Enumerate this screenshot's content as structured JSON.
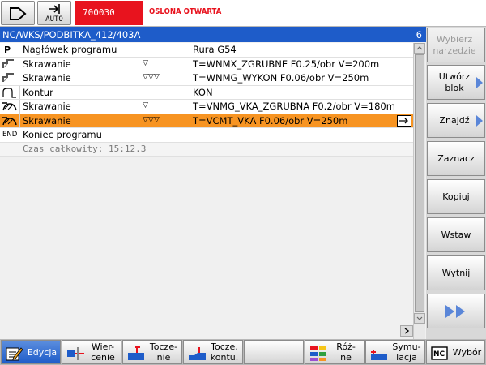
{
  "header": {
    "mode_label": "AUTO",
    "alarm_number": "700030",
    "alarm_text": "OSLONA OTWARTA",
    "alarm_color": "#e8131e"
  },
  "editor": {
    "title": "NC/WKS/PODBITKA_412/403A",
    "count": "6",
    "rows": [
      {
        "icon": "program-header-icon",
        "icon_text": "P",
        "name": "Nagłówek programu",
        "mark": "",
        "param": "Rura G54"
      },
      {
        "icon": "turning-icon",
        "icon_text": "",
        "name": "Skrawanie",
        "mark": "▽",
        "param": "T=WNMX_ZGRUBNE F0.25/obr V=200m"
      },
      {
        "icon": "turning-icon",
        "icon_text": "",
        "name": "Skrawanie",
        "mark": "▽▽▽",
        "param": "T=WNMG_WYKON F0.06/obr V=250m"
      },
      {
        "icon": "contour-icon",
        "icon_text": "",
        "name": "Kontur",
        "mark": "",
        "param": "KON"
      },
      {
        "icon": "contour-turning-icon",
        "icon_text": "",
        "name": "Skrawanie",
        "mark": "▽",
        "param": "T=VNMG_VKA_ZGRUBNA F0.2/obr V=180m"
      },
      {
        "icon": "contour-turning-icon",
        "icon_text": "",
        "name": "Skrawanie",
        "mark": "▽▽▽",
        "param": "T=VCMT_VKA F0.06/obr V=250m"
      },
      {
        "icon": "end-icon",
        "icon_text": "END",
        "name": "Koniec programu",
        "mark": "",
        "param": ""
      }
    ],
    "total_time": "Czas całkowity:  15:12.3",
    "selected_color": "#f79422",
    "title_color": "#1e5cc9"
  },
  "vertical_softkeys": {
    "select_tool": "Wybierz narzedzie",
    "create_block": "Utwórz blok",
    "find": "Znajdź",
    "mark": "Zaznacz",
    "copy": "Kopiuj",
    "paste": "Wstaw",
    "cut": "Wytnij"
  },
  "horizontal_softkeys": {
    "edit": "Edycja",
    "drilling": "Wier-\ncenie",
    "turning": "Tocze-\nnie",
    "contour_turning": "Tocze.\nkontu.",
    "misc": "Róż-\nne",
    "simulation": "Symu-\nlacja",
    "select": "Wybór"
  }
}
